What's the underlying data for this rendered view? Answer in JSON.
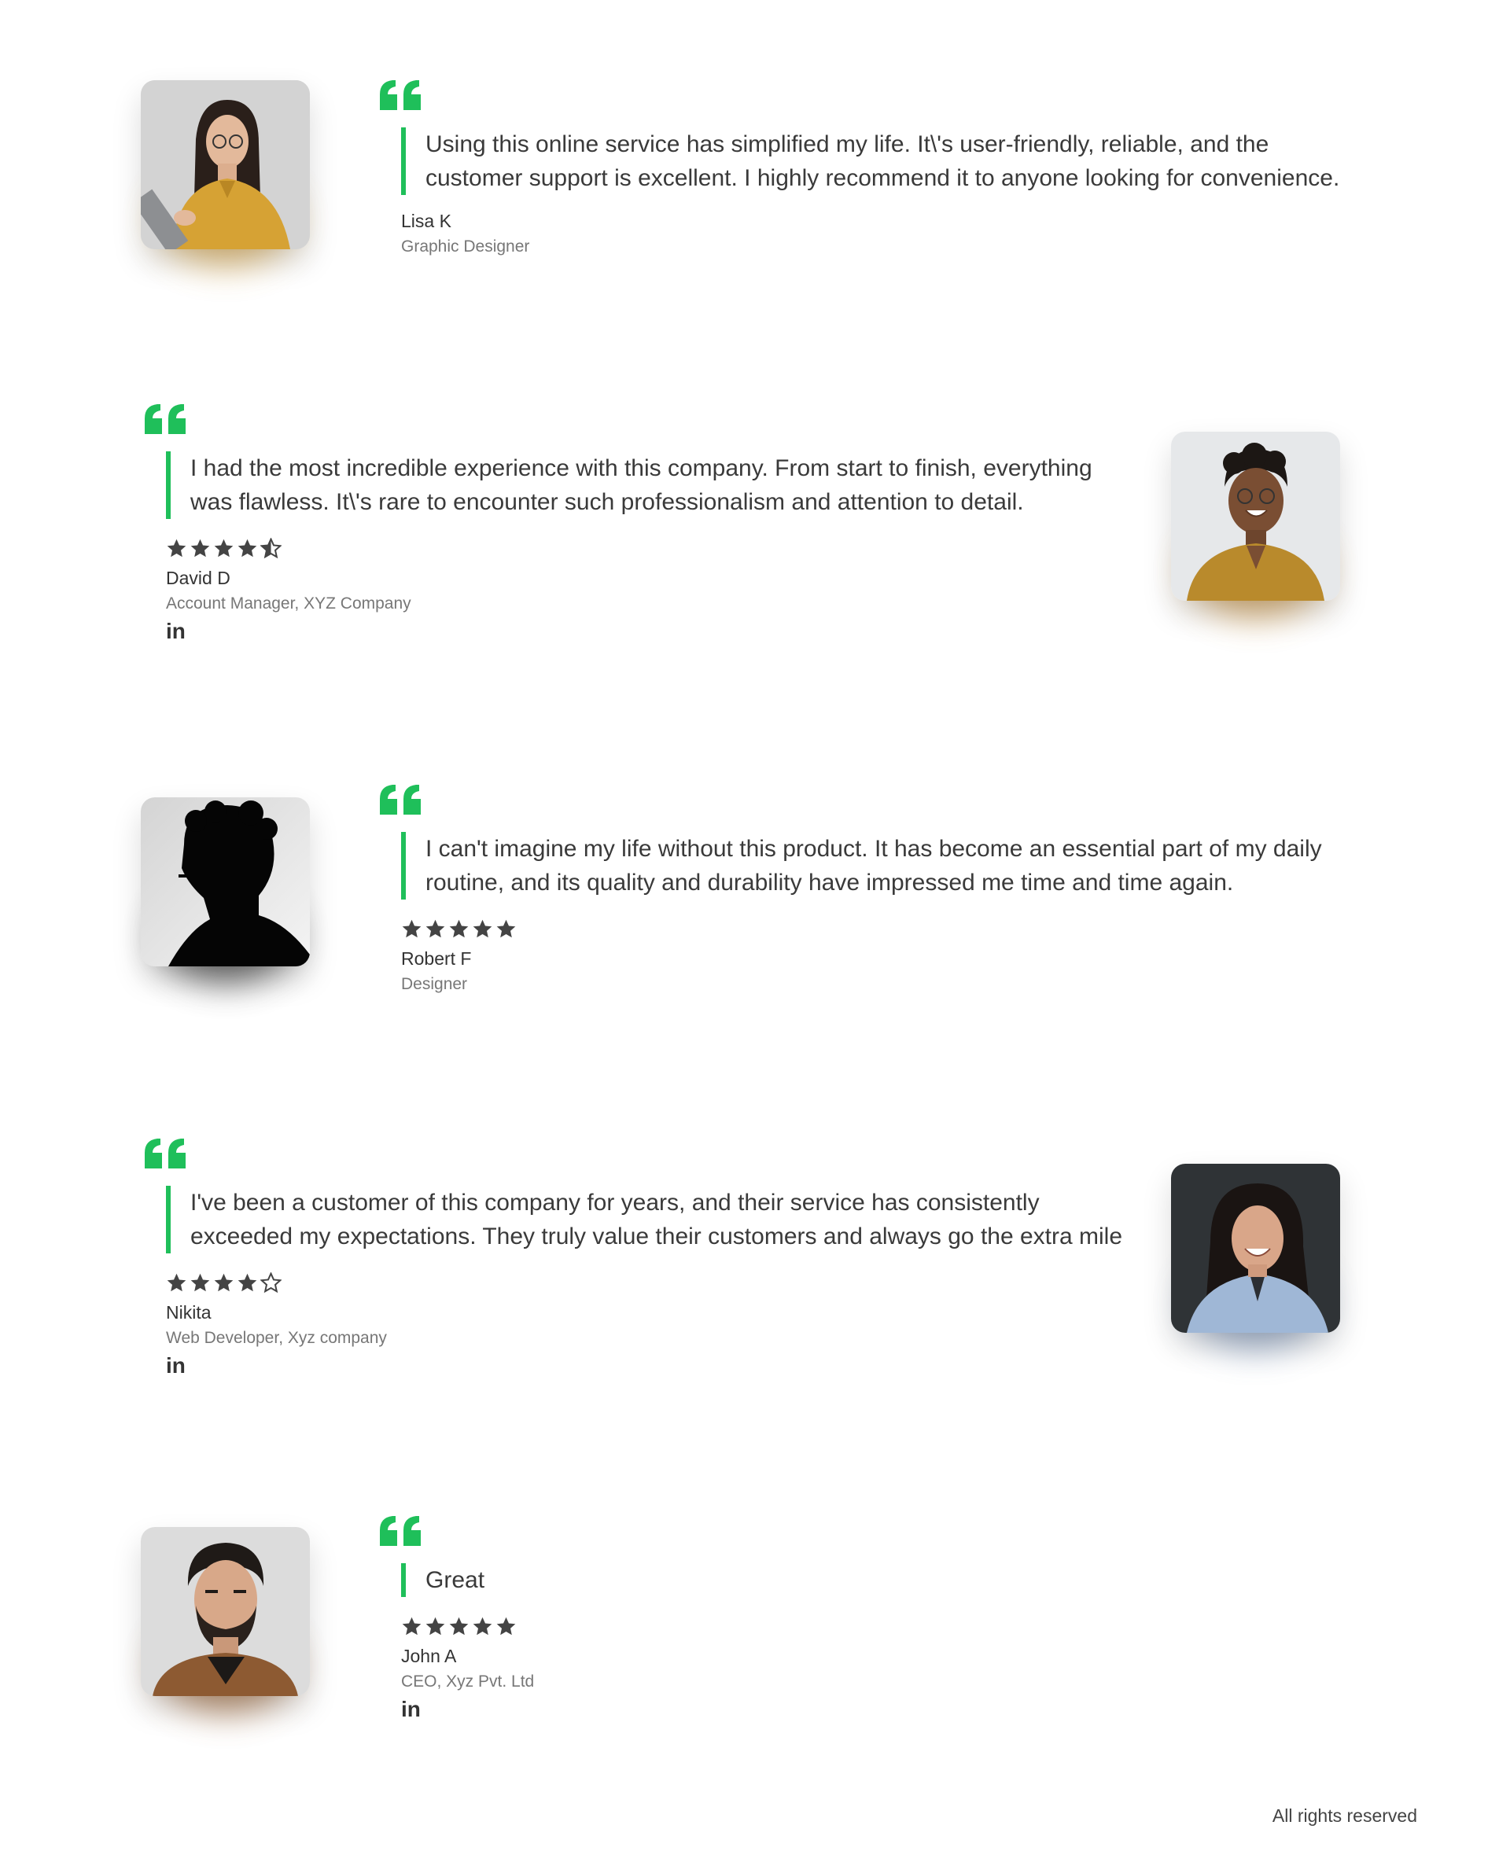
{
  "colors": {
    "accent": "#1fbf5a",
    "text": "#3a3a3a",
    "muted": "#777777",
    "star": "#444444"
  },
  "testimonials": [
    {
      "photo_icon": "avatar-woman-tablet",
      "quote": "Using this online service has simplified my life. It\\'s user-friendly, reliable, and the customer support is excellent. I highly recommend it to anyone looking for convenience.",
      "rating": null,
      "name": "Lisa K",
      "title": "Graphic Designer",
      "linkedin": null
    },
    {
      "photo_icon": "avatar-woman-smiling",
      "quote": "I had the most incredible experience with this company. From start to finish, everything was flawless. It\\'s rare to encounter such professionalism and attention to detail.",
      "rating": 4.5,
      "name": "David D",
      "title": "Account Manager, XYZ Company",
      "linkedin": "in"
    },
    {
      "photo_icon": "avatar-silhouette",
      "quote": "I can't imagine my life without this product. It has become an essential part of my daily routine, and its quality and durability have impressed me time and time again.",
      "rating": 5,
      "name": "Robert F",
      "title": "Designer",
      "linkedin": null
    },
    {
      "photo_icon": "avatar-woman-laughing",
      "quote": "I've been a customer of this company for years, and their service has consistently exceeded my expectations. They truly value their customers and always go the extra mile",
      "rating": 4,
      "name": "Nikita",
      "title": "Web Developer, Xyz company",
      "linkedin": "in"
    },
    {
      "photo_icon": "avatar-bearded-man",
      "quote": "Great",
      "rating": 5,
      "name": "John A",
      "title": "CEO, Xyz Pvt. Ltd",
      "linkedin": "in"
    }
  ],
  "footer": {
    "text": "All rights reserved"
  }
}
